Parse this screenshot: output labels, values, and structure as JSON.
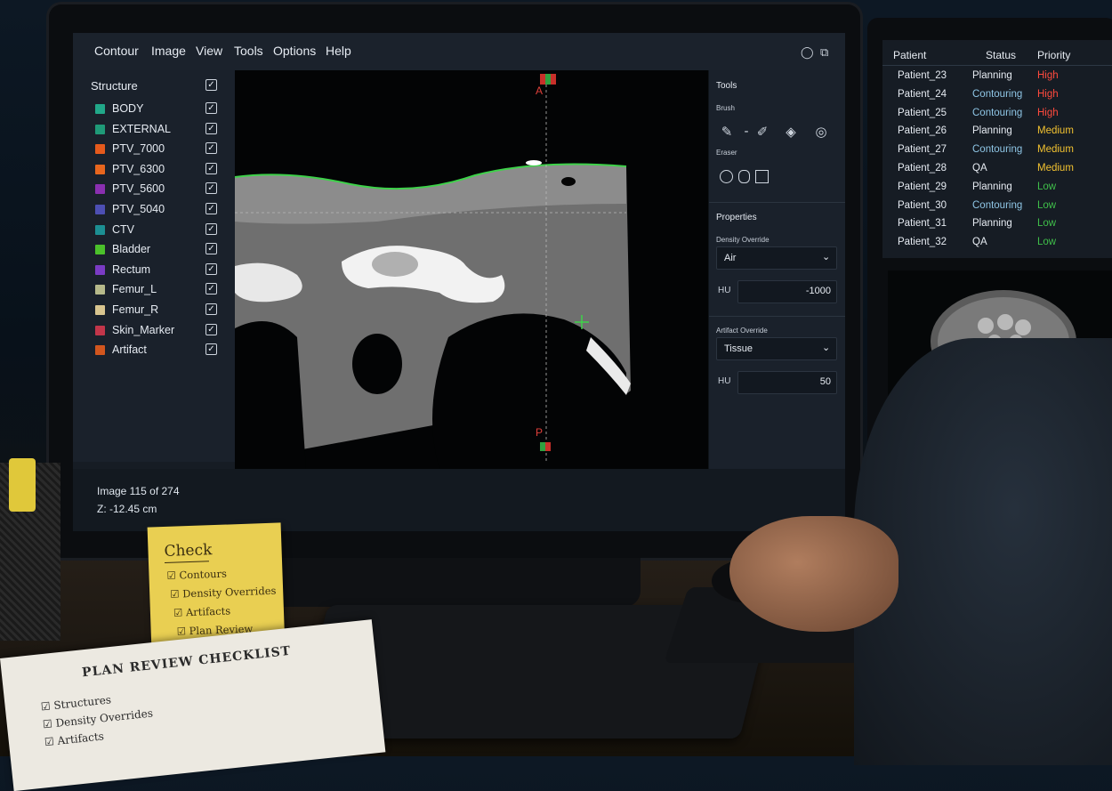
{
  "menu": [
    "Contour",
    "Image",
    "View",
    "Tools",
    "Options",
    "Help"
  ],
  "structures": {
    "header": "Structure",
    "items": [
      {
        "name": "BODY",
        "color": "#21a889",
        "checked": true
      },
      {
        "name": "EXTERNAL",
        "color": "#1f9a78",
        "checked": true
      },
      {
        "name": "PTV_7000",
        "color": "#e55a1c",
        "checked": true
      },
      {
        "name": "PTV_6300",
        "color": "#e8661e",
        "checked": true
      },
      {
        "name": "PTV_5600",
        "color": "#8a2fb0",
        "checked": true
      },
      {
        "name": "PTV_5040",
        "color": "#4d4fb3",
        "checked": true
      },
      {
        "name": "CTV",
        "color": "#1c8f93",
        "checked": true
      },
      {
        "name": "Bladder",
        "color": "#4bc12b",
        "checked": true
      },
      {
        "name": "Rectum",
        "color": "#7a3bc4",
        "checked": true
      },
      {
        "name": "Femur_L",
        "color": "#b6b98a",
        "checked": true
      },
      {
        "name": "Femur_R",
        "color": "#d8c58f",
        "checked": true
      },
      {
        "name": "Skin_Marker",
        "color": "#c2364a",
        "checked": true
      },
      {
        "name": "Artifact",
        "color": "#d2561e",
        "checked": true
      }
    ]
  },
  "viewer": {
    "label_top": "A",
    "label_bottom": "P"
  },
  "tools": {
    "title": "Tools",
    "brush_label": "Brush",
    "eraser_label": "Eraser",
    "properties_title": "Properties",
    "density_label": "Density Override",
    "density_value": "Air",
    "hu1_label": "HU",
    "hu1_value": "-1000",
    "artifact_label": "Artifact Override",
    "artifact_value": "Tissue",
    "hu2_label": "HU",
    "hu2_value": "50"
  },
  "status": {
    "image": "Image 115 of 274",
    "z": "Z: -12.45 cm"
  },
  "patients": {
    "headers": [
      "Patient",
      "Status",
      "Priority"
    ],
    "rows": [
      {
        "patient": "Patient_23",
        "status": "Planning",
        "priority": "High",
        "color": "#ff4a3d"
      },
      {
        "patient": "Patient_24",
        "status": "Contouring",
        "priority": "High",
        "color": "#ff4a3d"
      },
      {
        "patient": "Patient_25",
        "status": "Contouring",
        "priority": "High",
        "color": "#ff4a3d"
      },
      {
        "patient": "Patient_26",
        "status": "Planning",
        "priority": "Medium",
        "color": "#f2c230"
      },
      {
        "patient": "Patient_27",
        "status": "Contouring",
        "priority": "Medium",
        "color": "#f2c230"
      },
      {
        "patient": "Patient_28",
        "status": "QA",
        "priority": "Medium",
        "color": "#f2c230"
      },
      {
        "patient": "Patient_29",
        "status": "Planning",
        "priority": "Low",
        "color": "#3fbf4a"
      },
      {
        "patient": "Patient_30",
        "status": "Contouring",
        "priority": "Low",
        "color": "#3fbf4a"
      },
      {
        "patient": "Patient_31",
        "status": "Planning",
        "priority": "Low",
        "color": "#3fbf4a"
      },
      {
        "patient": "Patient_32",
        "status": "QA",
        "priority": "Low",
        "color": "#3fbf4a"
      }
    ]
  },
  "sticky": {
    "title": "Check",
    "items": [
      "Contours",
      "Density Overrides",
      "Artifacts",
      "Plan Review"
    ]
  },
  "paper": {
    "title": "PLAN REVIEW CHECKLIST",
    "items": [
      "Structures",
      "Density Overrides",
      "Artifacts"
    ]
  }
}
